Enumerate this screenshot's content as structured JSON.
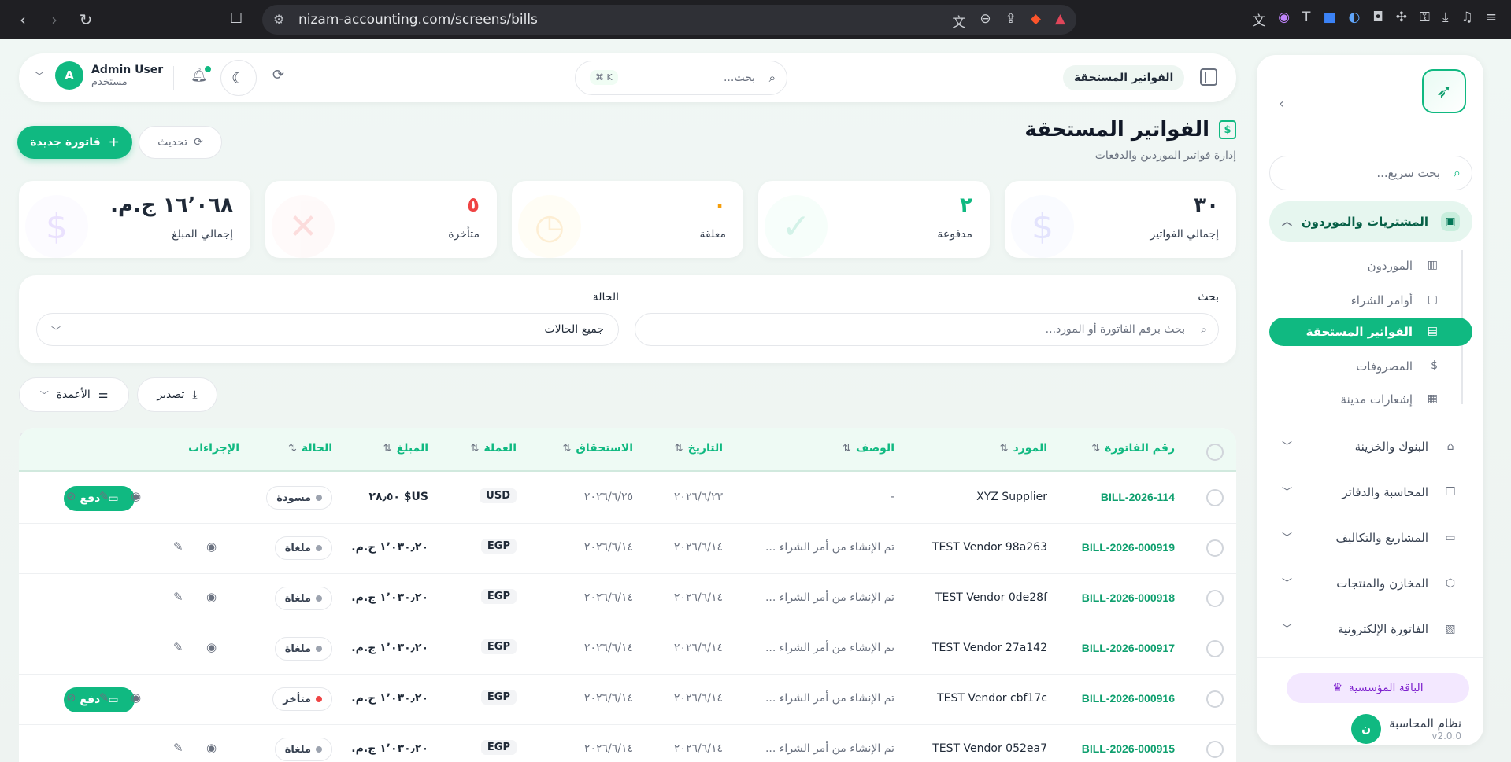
{
  "browser": {
    "url": "nizam-accounting.com/screens/bills"
  },
  "topbar": {
    "user_name": "Admin User",
    "user_role": "مستخدم",
    "avatar_letter": "A",
    "search_placeholder": "بحث...",
    "search_shortcut": "⌘ K",
    "breadcrumb": "الفواتير المستحقة"
  },
  "sidebar": {
    "search_placeholder": "بحث سريع...",
    "groups": [
      {
        "label": "المشتريات والموردون",
        "open": true
      },
      {
        "label": "البنوك والخزينة"
      },
      {
        "label": "المحاسبة والدفاتر"
      },
      {
        "label": "المشاريع والتكاليف"
      },
      {
        "label": "المخازن والمنتجات"
      },
      {
        "label": "الفاتورة الإلكترونية"
      }
    ],
    "sub_items": [
      {
        "label": "الموردون"
      },
      {
        "label": "أوامر الشراء"
      },
      {
        "label": "الفواتير المستحقة",
        "active": true
      },
      {
        "label": "المصروفات"
      },
      {
        "label": "إشعارات مدينة"
      }
    ],
    "plan_label": "الباقة المؤسسية",
    "app_name": "نظام المحاسبة",
    "version": "v2.0.0",
    "avatar_letter": "ن"
  },
  "page": {
    "title": "الفواتير المستحقة",
    "subtitle": "إدارة فواتير الموردين والدفعات",
    "new_button": "فاتورة جديدة",
    "refresh_button": "تحديث"
  },
  "stats": [
    {
      "value": "٣٠",
      "label": "إجمالي الفواتير",
      "color": "#111827"
    },
    {
      "value": "٢",
      "label": "مدفوعة",
      "color": "#10b981"
    },
    {
      "value": "٠",
      "label": "معلقة",
      "color": "#f59e0b"
    },
    {
      "value": "٥",
      "label": "متأخرة",
      "color": "#ef4444"
    },
    {
      "value": "١٦٬٠٦٨ ج.م.",
      "label": "إجمالي المبلغ",
      "color": "#111827"
    }
  ],
  "filters": {
    "search_label": "بحث",
    "search_placeholder": "بحث برقم الفاتورة أو المورد...",
    "status_label": "الحالة",
    "status_value": "جميع الحالات"
  },
  "toolbar": {
    "export_label": "تصدير",
    "columns_label": "الأعمدة"
  },
  "table": {
    "headers": {
      "bill_no": "رقم الفاتورة",
      "vendor": "المورد",
      "description": "الوصف",
      "date": "التاريخ",
      "due": "الاستحقاق",
      "currency": "العملة",
      "amount": "المبلغ",
      "status": "الحالة",
      "actions": "الإجراءات"
    },
    "pay_label": "دفع",
    "rows": [
      {
        "bill_no": "BILL-2026-114",
        "vendor": "XYZ Supplier",
        "description": "-",
        "date": "٢٠٢٦/٦/٢٣",
        "due": "٢٠٢٦/٦/٢٥",
        "currency": "USD",
        "amount": "US$ ٢٨٫٥٠",
        "status": "مسودة",
        "late": false,
        "payable": true
      },
      {
        "bill_no": "BILL-2026-000919",
        "vendor": "TEST Vendor 98a263",
        "description": "تم الإنشاء من أمر الشراء ...",
        "date": "٢٠٢٦/٦/١٤",
        "due": "٢٠٢٦/٦/١٤",
        "currency": "EGP",
        "amount": "١٬٠٣٠٫٢٠ ج.م.",
        "status": "ملغاة",
        "late": false,
        "payable": false
      },
      {
        "bill_no": "BILL-2026-000918",
        "vendor": "TEST Vendor 0de28f",
        "description": "تم الإنشاء من أمر الشراء ...",
        "date": "٢٠٢٦/٦/١٤",
        "due": "٢٠٢٦/٦/١٤",
        "currency": "EGP",
        "amount": "١٬٠٣٠٫٢٠ ج.م.",
        "status": "ملغاة",
        "late": false,
        "payable": false
      },
      {
        "bill_no": "BILL-2026-000917",
        "vendor": "TEST Vendor 27a142",
        "description": "تم الإنشاء من أمر الشراء ...",
        "date": "٢٠٢٦/٦/١٤",
        "due": "٢٠٢٦/٦/١٤",
        "currency": "EGP",
        "amount": "١٬٠٣٠٫٢٠ ج.م.",
        "status": "ملغاة",
        "late": false,
        "payable": false
      },
      {
        "bill_no": "BILL-2026-000916",
        "vendor": "TEST Vendor cbf17c",
        "description": "تم الإنشاء من أمر الشراء ...",
        "date": "٢٠٢٦/٦/١٤",
        "due": "٢٠٢٦/٦/١٤",
        "currency": "EGP",
        "amount": "١٬٠٣٠٫٢٠ ج.م.",
        "status": "متأخر",
        "late": true,
        "payable": true
      },
      {
        "bill_no": "BILL-2026-000915",
        "vendor": "TEST Vendor 052ea7",
        "description": "تم الإنشاء من أمر الشراء ...",
        "date": "٢٠٢٦/٦/١٤",
        "due": "٢٠٢٦/٦/١٤",
        "currency": "EGP",
        "amount": "١٬٠٣٠٫٢٠ ج.م.",
        "status": "ملغاة",
        "late": false,
        "payable": false
      }
    ]
  },
  "colors": {
    "accent": "#10b981",
    "danger": "#ef4444",
    "warning": "#f59e0b",
    "plan": "#7e22ce"
  }
}
